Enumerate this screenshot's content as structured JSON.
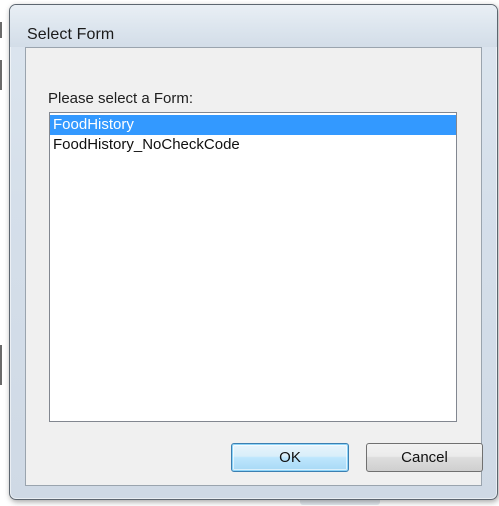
{
  "dialog": {
    "title": "Select Form",
    "prompt": "Please select a Form:",
    "forms": [
      {
        "label": "FoodHistory",
        "selected": true
      },
      {
        "label": "FoodHistory_NoCheckCode",
        "selected": false
      }
    ],
    "ok_label": "OK",
    "cancel_label": "Cancel"
  },
  "colors": {
    "selection": "#3399ff",
    "default_button_border": "#3c7fb1",
    "window_frame": "#d5dfea"
  }
}
